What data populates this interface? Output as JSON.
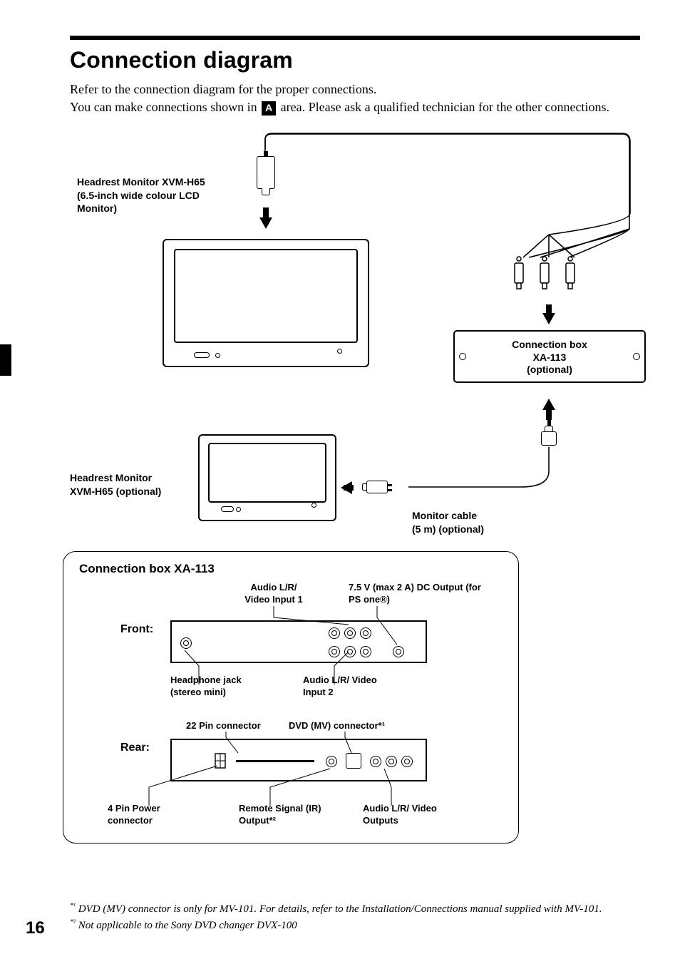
{
  "page_number": "16",
  "title": "Connection diagram",
  "intro_1": "Refer to the connection diagram for the proper connections.",
  "intro_2a": "You can make connections shown in ",
  "intro_2_letter": "A",
  "intro_2b": " area. Please ask a qualified technician for the other connections.",
  "diagram": {
    "headrest_label": "Headrest Monitor XVM-H65 (6.5-inch wide colour LCD Monitor)",
    "headrest_opt_label": "Headrest Monitor XVM-H65 (optional)",
    "connbox_label_1": "Connection box",
    "connbox_label_2": "XA-113",
    "connbox_label_3": "(optional)",
    "monitor_cable_label_1": "Monitor cable",
    "monitor_cable_label_2": "(5 m) (optional)",
    "xa113_title": "Connection box XA-113",
    "front_label": "Front:",
    "rear_label": "Rear:",
    "audio_in1": "Audio L/R/ Video Input 1",
    "audio_in2": "Audio L/R/ Video Input 2",
    "dc_out": "7.5 V (max 2 A) DC Output (for PS one®)",
    "headphone": "Headphone jack (stereo mini)",
    "pin22": "22 Pin connector",
    "dvd_conn": "DVD (MV) connector*¹",
    "pin4": "4 Pin Power connector",
    "remote_ir": "Remote Signal (IR) Output*²",
    "audio_out": "Audio L/R/ Video Outputs"
  },
  "footnote1_marker": "*¹",
  "footnote1": " DVD (MV) connector is only for MV-101. For details, refer to the Installation/Connections manual supplied with MV-101.",
  "footnote2_marker": "*²",
  "footnote2": " Not applicable to the Sony DVD changer DVX-100"
}
